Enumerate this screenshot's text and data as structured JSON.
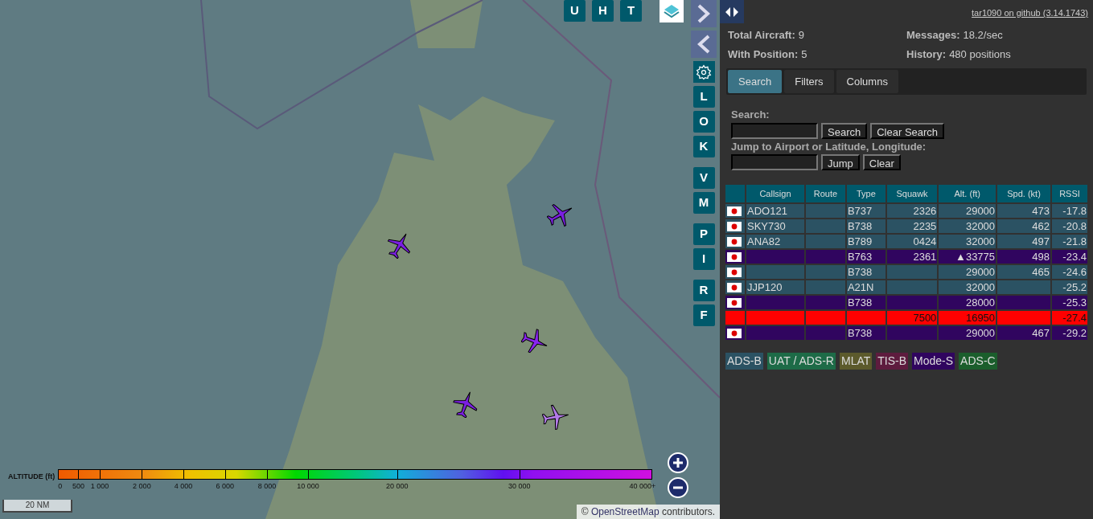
{
  "top_buttons": [
    "U",
    "H",
    "T"
  ],
  "side_button_groups": [
    [
      "L",
      "O",
      "K"
    ],
    [
      "V",
      "M"
    ],
    [
      "P",
      "I"
    ],
    [
      "R",
      "F"
    ]
  ],
  "aircraft_markers": [
    {
      "color": "#7a1fe0"
    },
    {
      "color": "#7a1fe0"
    },
    {
      "color": "#8a24f0"
    },
    {
      "color": "#7a1fe0"
    },
    {
      "color": "#b27ae8"
    }
  ],
  "altitude_legend": {
    "title": "ALTITUDE (ft)",
    "labels": [
      "0",
      "500",
      "1 000",
      "2 000",
      "4 000",
      "6 000",
      "8 000",
      "10 000",
      "20 000",
      "30 000",
      "40 000+"
    ]
  },
  "scale_bar": "20 NM",
  "attribution": {
    "prefix": "© ",
    "link": "OpenStreetMap",
    "suffix": " contributors."
  },
  "version_link": "tar1090 on github (3.14.1743)",
  "stats": [
    {
      "label": "Total Aircraft:",
      "value": "9"
    },
    {
      "label": "Messages:",
      "value": "18.2/sec"
    },
    {
      "label": "With Position:",
      "value": "5"
    },
    {
      "label": "History:",
      "value": "480 positions"
    }
  ],
  "tabs": [
    {
      "label": "Search",
      "selected": true
    },
    {
      "label": "Filters",
      "selected": false
    },
    {
      "label": "Columns",
      "selected": false
    }
  ],
  "search": {
    "label": "Search:",
    "button": "Search",
    "clear": "Clear Search"
  },
  "jump": {
    "label": "Jump to Airport or Latitude, Longitude:",
    "button": "Jump",
    "clear": "Clear"
  },
  "table": {
    "columns": [
      "Callsign",
      "Route",
      "Type",
      "Squawk",
      "Alt. (ft)",
      "Spd. (kt)",
      "RSSI"
    ],
    "rows": [
      {
        "kind": "adsb",
        "flag": true,
        "callsign": "ADO121",
        "type": "B737",
        "squawk": "2326",
        "alt": "29000",
        "spd": "473",
        "rssi": "-17.8"
      },
      {
        "kind": "adsb",
        "flag": true,
        "callsign": "SKY730",
        "type": "B738",
        "squawk": "2235",
        "alt": "32000",
        "spd": "462",
        "rssi": "-20.8"
      },
      {
        "kind": "adsb",
        "flag": true,
        "callsign": "ANA82",
        "type": "B789",
        "squawk": "0424",
        "alt": "32000",
        "spd": "497",
        "rssi": "-21.8"
      },
      {
        "kind": "modes",
        "flag": true,
        "callsign": "",
        "type": "B763",
        "squawk": "2361",
        "alt": "▲33775",
        "spd": "498",
        "rssi": "-23.4"
      },
      {
        "kind": "adsb",
        "flag": true,
        "callsign": "",
        "type": "B738",
        "squawk": "",
        "alt": "29000",
        "spd": "465",
        "rssi": "-24.6"
      },
      {
        "kind": "adsb",
        "flag": true,
        "callsign": "JJP120",
        "type": "A21N",
        "squawk": "",
        "alt": "32000",
        "spd": "",
        "rssi": "-25.2"
      },
      {
        "kind": "modes",
        "flag": true,
        "callsign": "",
        "type": "B738",
        "squawk": "",
        "alt": "28000",
        "spd": "",
        "rssi": "-25.3"
      },
      {
        "kind": "emergency",
        "flag": false,
        "callsign": "",
        "type": "",
        "squawk": "7500",
        "alt": "16950",
        "spd": "",
        "rssi": "-27.4"
      },
      {
        "kind": "modes",
        "flag": true,
        "callsign": "",
        "type": "B738",
        "squawk": "",
        "alt": "29000",
        "spd": "467",
        "rssi": "-29.2"
      }
    ]
  },
  "source_legend": [
    {
      "label": "ADS-B",
      "color": "#2b5263"
    },
    {
      "label": "UAT / ADS-R",
      "color": "#1d6b47"
    },
    {
      "label": "MLAT",
      "color": "#5c5a2c"
    },
    {
      "label": "TIS-B",
      "color": "#5e1c3e"
    },
    {
      "label": "Mode-S",
      "color": "#30055f"
    },
    {
      "label": "ADS-C",
      "color": "#1b5e2c"
    }
  ]
}
